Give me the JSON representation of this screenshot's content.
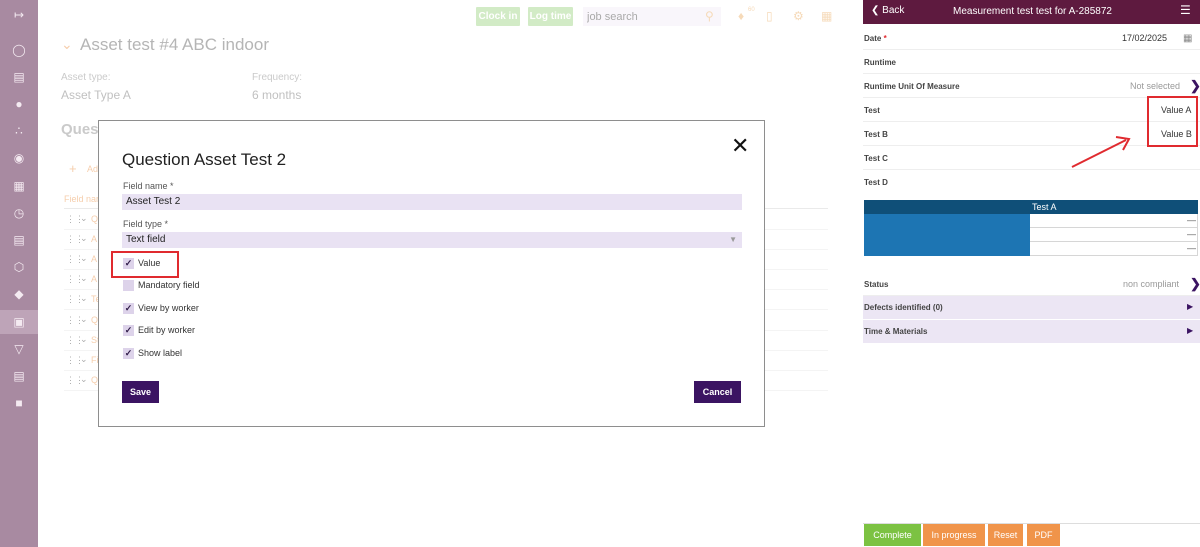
{
  "rail": {
    "icons": [
      "collapse-icon",
      "tag-icon",
      "document-icon",
      "person-icon",
      "share-icon",
      "location-icon",
      "map-icon",
      "clock-icon",
      "clipboard-icon",
      "box-icon",
      "price-tag-icon",
      "scan-icon",
      "shield-icon",
      "book-icon",
      "chat-icon"
    ],
    "active_index": 11
  },
  "topbar": {
    "clock_in": "Clock in",
    "log_time": "Log time",
    "search_placeholder": "job search",
    "notification_count": "60"
  },
  "asset": {
    "title": "Asset test #4 ABC indoor",
    "asset_type_label": "Asset type:",
    "asset_type_value": "Asset Type A",
    "frequency_label": "Frequency:",
    "frequency_value": "6 months",
    "questions_fragment": "Ques",
    "add_fragment": "Ad",
    "field_name_fragment": "Field nar",
    "row_fragments": [
      "Q",
      "A",
      "A",
      "A",
      "Te",
      "Q",
      "St",
      "Fi",
      "Q"
    ]
  },
  "modal": {
    "title": "Question Asset Test 2",
    "field_name_label": "Field name *",
    "field_name_value": "Asset Test 2",
    "field_type_label": "Field type *",
    "field_type_value": "Text field",
    "checkboxes": [
      {
        "label": "Value",
        "checked": true
      },
      {
        "label": "Mandatory field",
        "checked": false
      },
      {
        "label": "View by worker",
        "checked": true
      },
      {
        "label": "Edit by worker",
        "checked": true
      },
      {
        "label": "Show label",
        "checked": true
      }
    ],
    "save_label": "Save",
    "cancel_label": "Cancel"
  },
  "phone": {
    "back_label": "Back",
    "title": "Measurement test test for A-285872",
    "date_label": "Date",
    "date_required": "*",
    "date_value": "17/02/2025",
    "runtime_label": "Runtime",
    "runtime_unit_label": "Runtime Unit Of Measure",
    "runtime_unit_value": "Not selected",
    "test_label": "Test",
    "test_value": "Value A",
    "test_b_label": "Test B",
    "test_b_value": "Value B",
    "test_c_label": "Test C",
    "test_d_label": "Test D",
    "table_header": "Test A",
    "table_rows": [
      "—",
      "—",
      "—"
    ],
    "status_label": "Status",
    "status_value": "non compliant",
    "defects_label": "Defects identified (0)",
    "time_materials_label": "Time & Materials",
    "buttons": [
      {
        "label": "Complete",
        "color": "#7cc242"
      },
      {
        "label": "In progress",
        "color": "#f0944a"
      },
      {
        "label": "Reset",
        "color": "#f0944a"
      },
      {
        "label": "PDF",
        "color": "#f0944a"
      }
    ]
  },
  "colors": {
    "rail": "#a88aa1",
    "accent": "#3b1462",
    "phone_header": "#5e1a3f",
    "highlight_red": "#e02a2f"
  }
}
